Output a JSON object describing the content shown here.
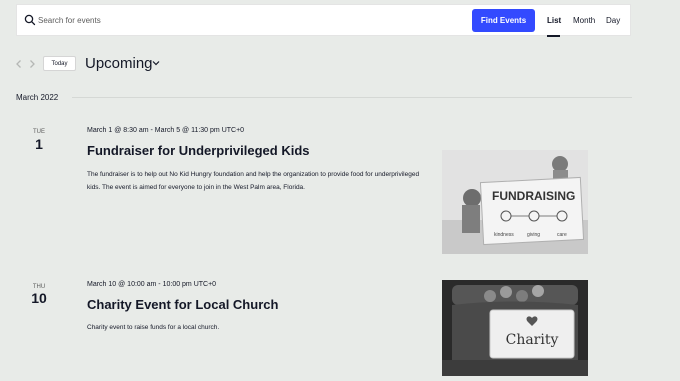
{
  "search": {
    "placeholder": "Search for events",
    "button_label": "Find Events"
  },
  "views": {
    "list": "List",
    "month": "Month",
    "day": "Day",
    "active": "List"
  },
  "nav": {
    "today_label": "Today",
    "range_label": "Upcoming"
  },
  "month_separator": "March 2022",
  "events": [
    {
      "dow": "TUE",
      "day": "1",
      "date_range": "March 1 @ 8:30 am - March 5 @ 11:30 pm UTC+0",
      "title": "Fundraiser for Underprivileged Kids",
      "description": "The fundraiser is to help out No Kid Hungry foundation and help the organization to provide food for underprivileged kids. The event is aimed for everyone to join in the West Palm area, Florida.",
      "image": {
        "sign_text": "FUNDRAISING",
        "labels": [
          "kindness",
          "giving",
          "care"
        ]
      }
    },
    {
      "dow": "THU",
      "day": "10",
      "date_range": "March 10 @ 10:00 am - 10:00 pm UTC+0",
      "title": "Charity Event for Local Church",
      "description": "Charity event to raise funds for a local church.",
      "image": {
        "label_text": "Charity"
      }
    }
  ],
  "colors": {
    "accent": "#334aff",
    "background": "#e8ebe8",
    "text": "#141827"
  }
}
